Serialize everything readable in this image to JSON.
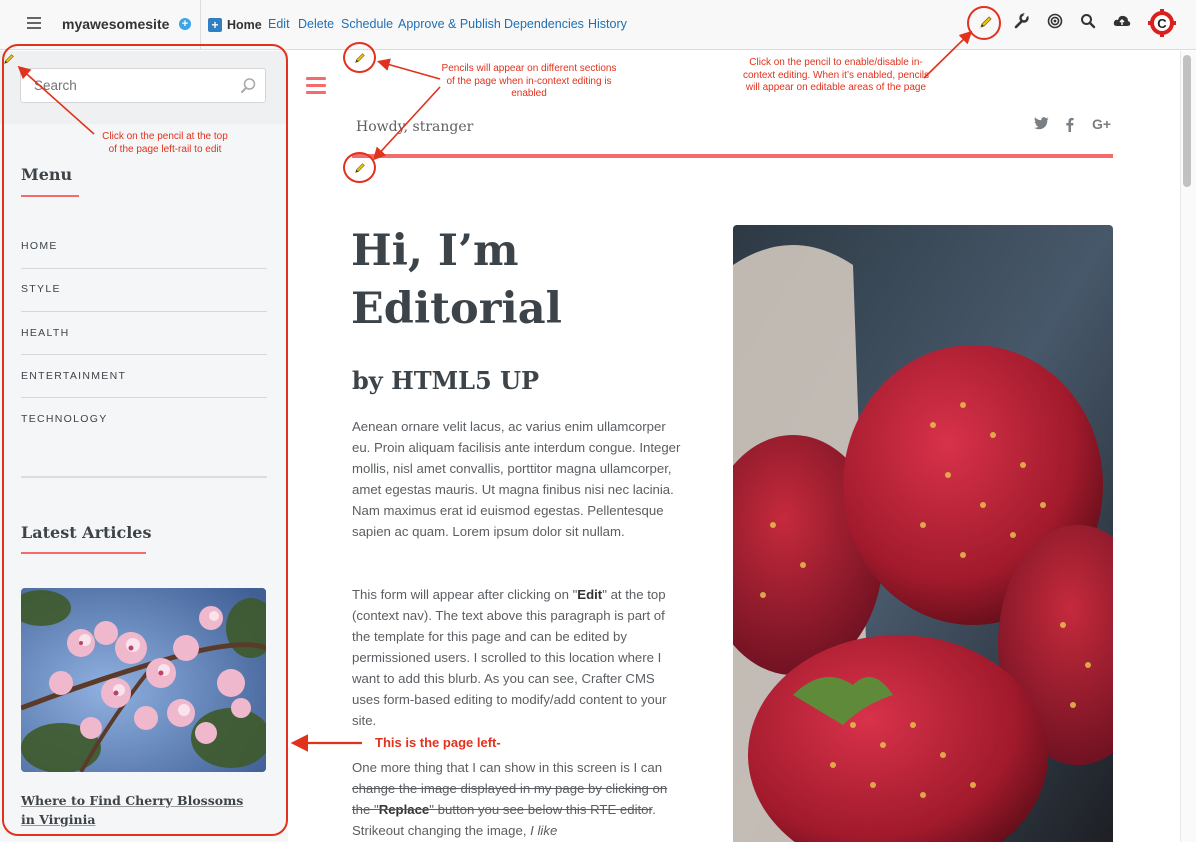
{
  "topbar": {
    "site_name": "myawesomesite",
    "nav": [
      "Home",
      "Edit",
      "Delete",
      "Schedule",
      "Approve & Publish",
      "Dependencies",
      "History"
    ]
  },
  "rail": {
    "search_placeholder": "Search",
    "menu_heading": "Menu",
    "menu_items": [
      "HOME",
      "STYLE",
      "HEALTH",
      "ENTERTAINMENT",
      "TECHNOLOGY"
    ],
    "articles_heading": "Latest Articles",
    "article_title": "Where to Find Cherry Blossoms in Virginia"
  },
  "header": {
    "greeting": "Howdy, stranger",
    "social": [
      "twitter-icon",
      "facebook-icon",
      "google-plus-icon"
    ]
  },
  "main": {
    "title": "Hi, I’m Editorial",
    "subtitle": "by HTML5 UP",
    "para1": "Aenean ornare velit lacus, ac varius enim ullamcorper eu. Proin aliquam facilisis ante interdum congue. Integer mollis, nisl amet convallis, porttitor magna ullamcorper, amet egestas mauris. Ut magna finibus nisi nec lacinia. Nam maximus erat id euismod egestas. Pellentesque sapien ac quam. Lorem ipsum dolor sit nullam.",
    "para2_a": "This form will appear after clicking on \"",
    "para2_bold": "Edit",
    "para2_b": "\" at the top (context nav).  The text above this paragraph is part of the template for this page and can be edited by permissioned users.  I scrolled to this location where I want to add this blurb.  As you can see, Crafter CMS uses form-based editing to modify/add content to your site.",
    "para3_a": "One more thing that I can show in this screen is I can ",
    "para3_strike_a": "change the image displayed in my page by clicking on the \"",
    "para3_strike_bold": "Replace",
    "para3_strike_b": "\" button you see below this RTE editor",
    "para3_b": ".  Strikeout changing the image, ",
    "para3_italic": "I like"
  },
  "annotations": {
    "pencils_sections": "Pencils will appear on different sections of the page when in-context editing is enabled",
    "pencil_toggle": "Click on the pencil to enable/disable in-context editing. When it’s enabled, pencils will appear on editable areas of the page",
    "pencil_leftrail": "Click on the pencil at the top of the page left-rail to edit",
    "page_left": "This is the page left-"
  },
  "colors": {
    "accent": "#f56a6a",
    "annotation": "#e0321d",
    "link": "#1f6fb5"
  }
}
